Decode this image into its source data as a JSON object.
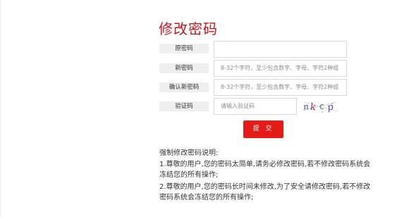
{
  "page": {
    "title": "修改密码"
  },
  "form": {
    "old_password": {
      "label": "原密码",
      "value": "",
      "placeholder": ""
    },
    "new_password": {
      "label": "新密码",
      "placeholder": "8-32个字符，至少包含数字、字母、字符2种组"
    },
    "confirm_password": {
      "label": "确认新密码",
      "placeholder": "8-32个字符，至少包含数字、字母、字符2种组"
    },
    "captcha": {
      "label": "验证码",
      "placeholder": "请输入验证码",
      "image_text": "nkcp"
    },
    "submit_label": "提 交"
  },
  "notes": {
    "title": "强制修改密码说明:",
    "items": [
      "1.尊敬的用户,您的密码太简单,请务必修改密码,若不修改密码系统会冻结您的所有操作;",
      "2.尊敬的用户,您的密码长时间未修改,为了安全请修改密码,若不修改密码系统会冻结您的所有操作;"
    ]
  },
  "colors": {
    "accent": "#c9151e",
    "button": "#e41b17",
    "label_bg": "#efefef"
  }
}
